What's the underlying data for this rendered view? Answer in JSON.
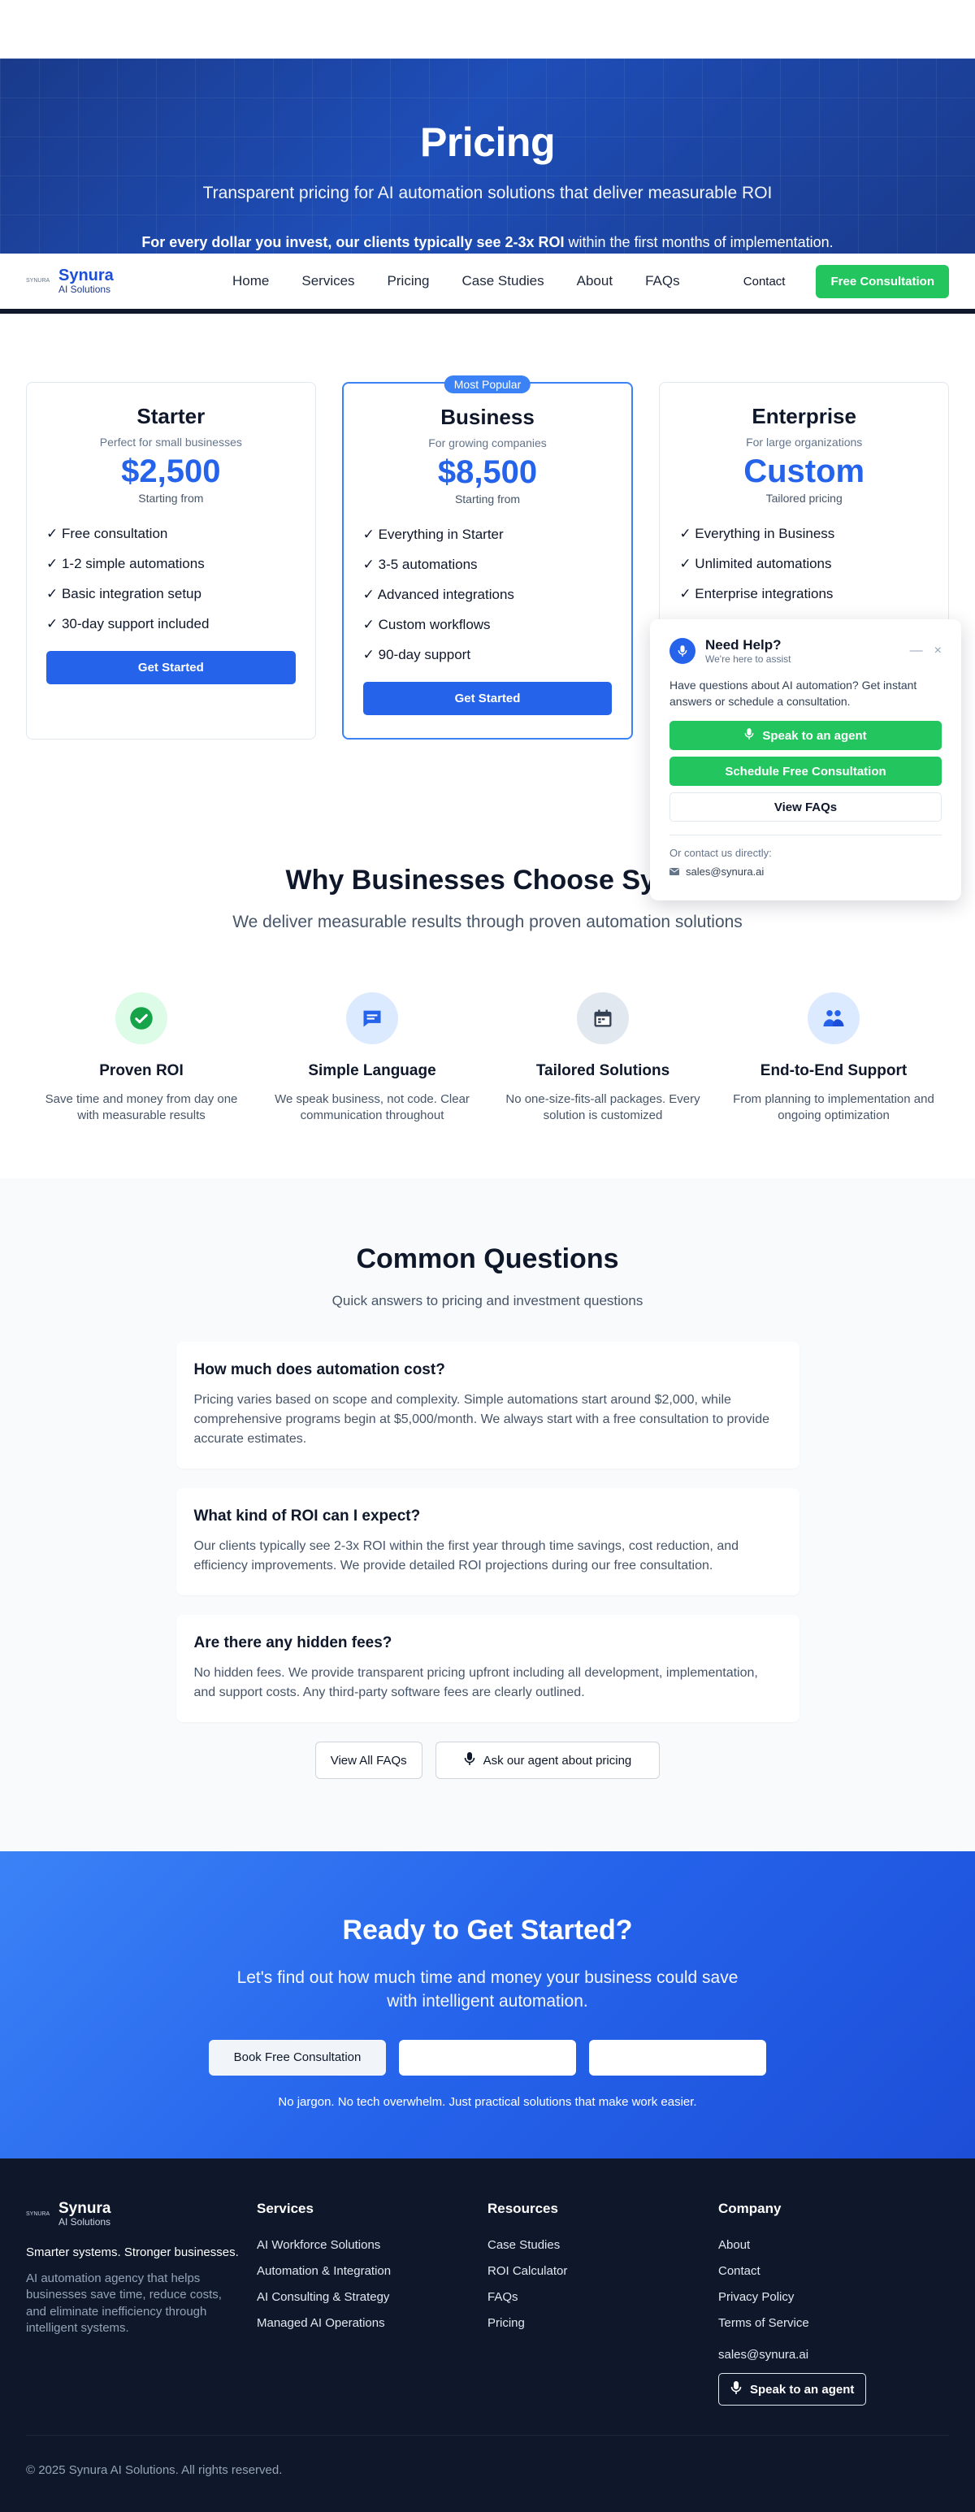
{
  "hero": {
    "title": "Pricing",
    "subtitle": "Transparent pricing for AI automation solutions that deliver measurable ROI",
    "roi_bold": "For every dollar you invest, our clients typically see 2-3x ROI",
    "roi_rest": " within the first months of implementation."
  },
  "brand": {
    "mark_text": "SYNURA",
    "name": "Synura",
    "tagline": "AI Solutions"
  },
  "nav": {
    "links": [
      "Home",
      "Services",
      "Pricing",
      "Case Studies",
      "About",
      "FAQs"
    ],
    "contact": "Contact",
    "cta": "Free Consultation"
  },
  "pricing": {
    "plans": [
      {
        "name": "Starter",
        "tagline": "Perfect for small businesses",
        "price": "$2,500",
        "price_note": "Starting from",
        "features": [
          "✓ Free consultation",
          "✓ 1-2 simple automations",
          "✓ Basic integration setup",
          "✓ 30-day support included"
        ],
        "button": "Get Started"
      },
      {
        "badge": "Most Popular",
        "name": "Business",
        "tagline": "For growing companies",
        "price": "$8,500",
        "price_note": "Starting from",
        "features": [
          "✓ Everything in Starter",
          "✓ 3-5 automations",
          "✓ Advanced integrations",
          "✓ Custom workflows",
          "✓ 90-day support"
        ],
        "button": "Get Started"
      },
      {
        "name": "Enterprise",
        "tagline": "For large organizations",
        "price": "Custom",
        "price_note": "Tailored pricing",
        "features": [
          "✓ Everything in Business",
          "✓ Unlimited automations",
          "✓ Enterprise integrations"
        ]
      }
    ]
  },
  "why": {
    "title": "Why Businesses Choose Synu",
    "subtitle": "We deliver measurable results through proven automation solutions",
    "items": [
      {
        "title": "Proven ROI",
        "text": "Save time and money from day one with measurable results",
        "icon": "check-circle-icon"
      },
      {
        "title": "Simple Language",
        "text": "We speak business, not code. Clear communication throughout",
        "icon": "chat-icon"
      },
      {
        "title": "Tailored Solutions",
        "text": "No one-size-fits-all packages. Every solution is customized",
        "icon": "calendar-icon"
      },
      {
        "title": "End-to-End Support",
        "text": "From planning to implementation and ongoing optimization",
        "icon": "support-icon"
      }
    ]
  },
  "faq": {
    "title": "Common Questions",
    "subtitle": "Quick answers to pricing and investment questions",
    "items": [
      {
        "q": "How much does automation cost?",
        "a": "Pricing varies based on scope and complexity. Simple automations start around $2,000, while comprehensive programs begin at $5,000/month. We always start with a free consultation to provide accurate estimates."
      },
      {
        "q": "What kind of ROI can I expect?",
        "a": "Our clients typically see 2-3x ROI within the first year through time savings, cost reduction, and efficiency improvements. We provide detailed ROI projections during our free consultation."
      },
      {
        "q": "Are there any hidden fees?",
        "a": "No hidden fees. We provide transparent pricing upfront including all development, implementation, and support costs. Any third-party software fees are clearly outlined."
      }
    ],
    "view_all": "View All FAQs",
    "ask_agent": "Ask our agent about pricing"
  },
  "cta": {
    "title": "Ready to Get Started?",
    "subtitle": "Let's find out how much time and money your business could save with intelligent automation.",
    "button_primary": "Book Free Consultation",
    "button_2": "",
    "button_3": "",
    "note": "No jargon. No tech overwhelm. Just practical solutions that make work easier."
  },
  "footer": {
    "slogan": "Smarter systems. Stronger businesses.",
    "description": "AI automation agency that helps businesses save time, reduce costs, and eliminate inefficiency through intelligent systems.",
    "columns": [
      {
        "title": "Services",
        "links": [
          "AI Workforce Solutions",
          "Automation & Integration",
          "AI Consulting & Strategy",
          "Managed AI Operations"
        ]
      },
      {
        "title": "Resources",
        "links": [
          "Case Studies",
          "ROI Calculator",
          "FAQs",
          "Pricing"
        ]
      },
      {
        "title": "Company",
        "links": [
          "About",
          "Contact",
          "Privacy Policy",
          "Terms of Service"
        ]
      }
    ],
    "email": "sales@synura.ai",
    "agent_button": "Speak to an agent",
    "copyright": "© 2025 Synura AI Solutions. All rights reserved."
  },
  "chat": {
    "title": "Need Help?",
    "subtitle": "We're here to assist",
    "message": "Have questions about AI automation? Get instant answers or schedule a consultation.",
    "speak_button": "Speak to an agent",
    "schedule_button": "Schedule Free Consultation",
    "faq_button": "View FAQs",
    "contact_label": "Or contact us directly:",
    "email": "sales@synura.ai",
    "minimize": "—",
    "close": "×"
  },
  "colors": {
    "primary": "#2563eb",
    "accent_green": "#22c55e",
    "dark": "#0f172a",
    "hero_blue": "#1e4eb8"
  }
}
